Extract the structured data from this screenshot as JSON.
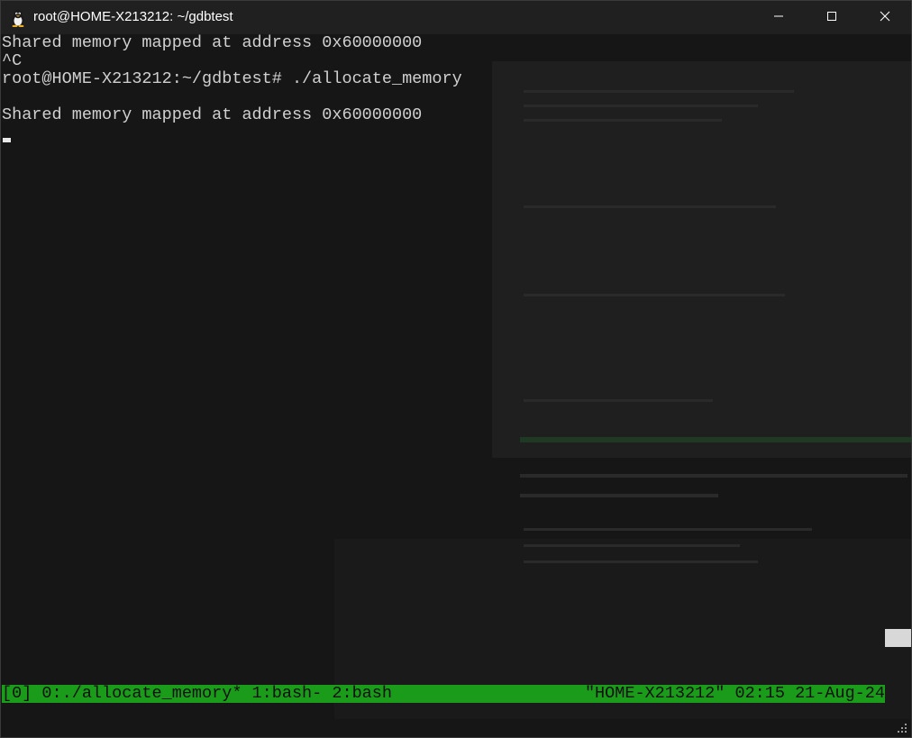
{
  "window": {
    "title": "root@HOME-X213212: ~/gdbtest",
    "app_icon": "tux-penguin-icon",
    "controls": {
      "minimize_icon": "minimize-icon",
      "maximize_icon": "maximize-icon",
      "close_icon": "close-icon"
    }
  },
  "terminal": {
    "lines": [
      "Shared memory mapped at address 0x60000000",
      "^C",
      "root@HOME-X213212:~/gdbtest# ./allocate_memory",
      "",
      "Shared memory mapped at address 0x60000000"
    ],
    "colors": {
      "background": "#161616",
      "foreground": "#d0d0d0"
    }
  },
  "tmux_status": {
    "left": "[0] 0:./allocate_memory* 1:bash- 2:bash",
    "right": "\"HOME-X213212\" 02:15 21-Aug-24",
    "color": "#1a9c1a"
  }
}
